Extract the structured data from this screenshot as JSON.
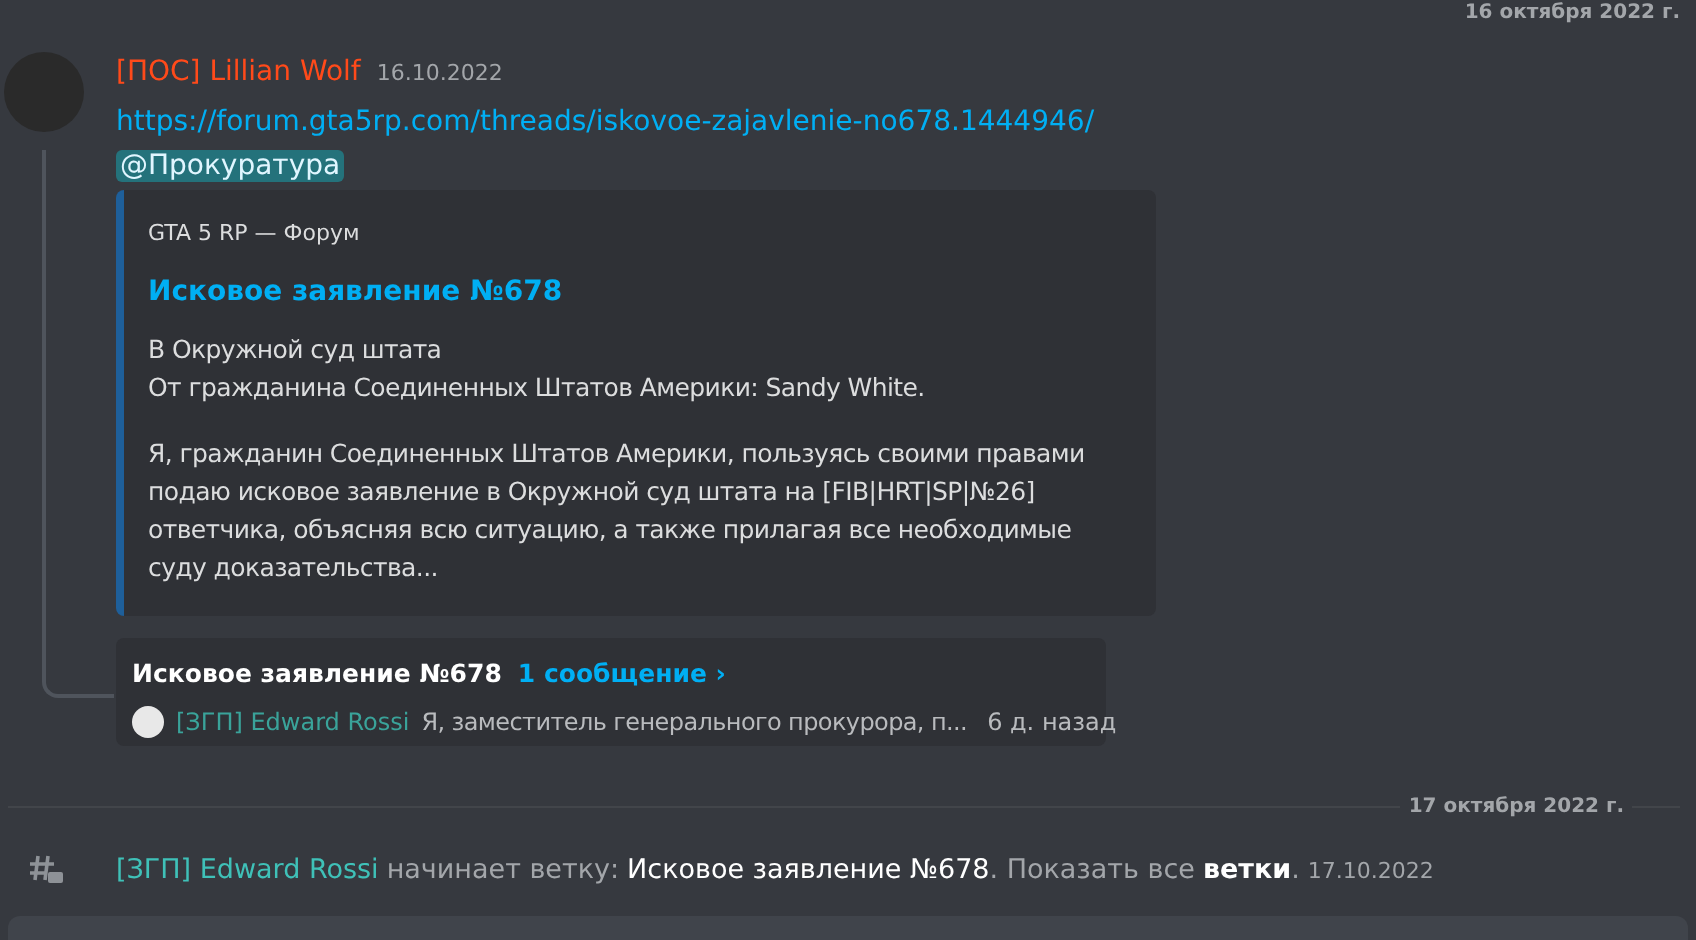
{
  "top_divider": {
    "date": "16 октября 2022 г."
  },
  "message": {
    "author": "[ПОС] Lillian Wolf",
    "timestamp": "16.10.2022",
    "link": "https://forum.gta5rp.com/threads/iskovoe-zajavlenie-no678.1444946/",
    "mention": "@Прокуратура",
    "embed": {
      "provider": "GTA 5 RP — Форум",
      "title": "Исковое заявление №678",
      "paragraphs": [
        "В Окружной суд штата\nОт гражданина Соединенных Штатов Америки: Sandy White.",
        "Я, гражданин Соединенных Штатов Америки, пользуясь своими правами подаю исковое заявление в Окружной суд штата на [FIB|HRT|SP|№26] ответчика, объясняя всю ситуацию, а также прилагая все необходимые суду доказательства..."
      ]
    },
    "thread": {
      "name": "Исковое заявление №678",
      "count": "1 сообщение ›",
      "last_author": "[ЗГП] Edward Rossi",
      "last_message": "Я, заместитель генерального прокурора, п...",
      "time": "6 д. назад"
    }
  },
  "divider": {
    "date": "17 октября 2022 г."
  },
  "system_message": {
    "author": "[ЗГП] Edward Rossi",
    "action": "начинает ветку:",
    "thread_name": "Исковое заявление №678",
    "show_all": ". Показать все",
    "threads_link": "ветки",
    "end": ".",
    "timestamp": "17.10.2022"
  }
}
